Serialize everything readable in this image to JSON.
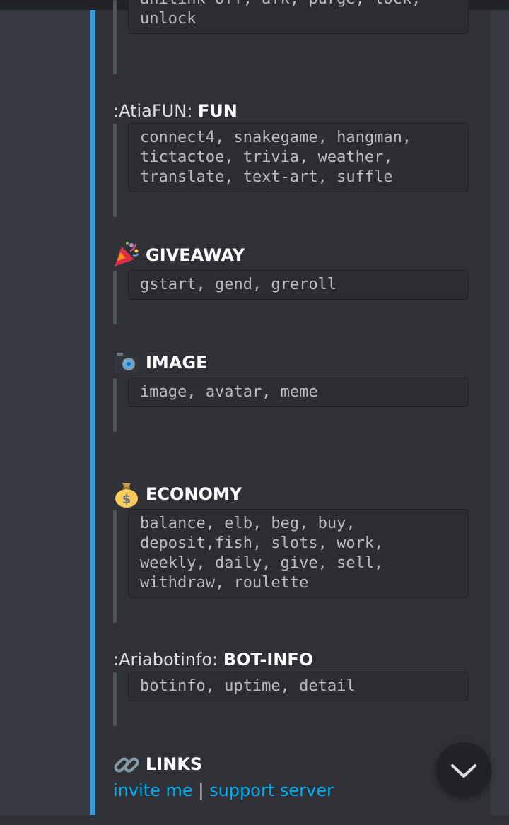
{
  "embed": {
    "accent": "#3498db",
    "fields": [
      {
        "id": "moderation-tail",
        "prefix": "",
        "name": "",
        "icon": "",
        "code": "anilink-off, afk, purge, lock,\nunlock"
      },
      {
        "id": "fun",
        "prefix": ":AtiaFUN: ",
        "name": "FUN",
        "icon": "",
        "code": "connect4, snakegame, hangman,\ntictactoe, trivia, weather,\ntranslate, text-art, suffle"
      },
      {
        "id": "giveaway",
        "prefix": "",
        "name": "GIVEAWAY",
        "icon": "party-popper-icon",
        "code": "gstart, gend, greroll"
      },
      {
        "id": "image",
        "prefix": "",
        "name": "IMAGE",
        "icon": "camera-icon",
        "code": "image, avatar, meme"
      },
      {
        "id": "economy",
        "prefix": "",
        "name": "ECONOMY",
        "icon": "money-bag-icon",
        "code": "balance, elb, beg, buy,\ndeposit,fish, slots, work,\nweekly, daily, give, sell,\nwithdraw, roulette"
      },
      {
        "id": "botinfo",
        "prefix": ":Ariabotinfo: ",
        "name": "BOT-INFO",
        "icon": "",
        "code": "botinfo, uptime, detail"
      }
    ],
    "links": {
      "icon": "link-icon",
      "name": "LINKS",
      "invite": "invite me",
      "separator": "|",
      "support": "support server"
    }
  },
  "scroll_button": {
    "icon": "chevron-down-icon"
  }
}
